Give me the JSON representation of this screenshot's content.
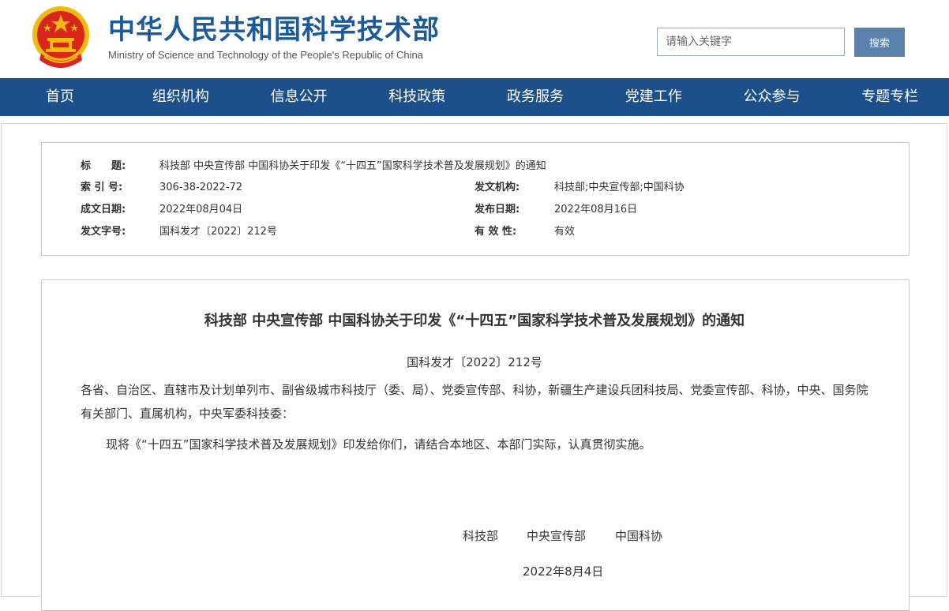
{
  "header": {
    "site_title": "中华人民共和国科学技术部",
    "site_subtitle": "Ministry of Science and Technology of the People's Republic of China",
    "search_placeholder": "请输入关键字",
    "search_button": "搜索"
  },
  "nav": {
    "items": [
      "首页",
      "组织机构",
      "信息公开",
      "科技政策",
      "政务服务",
      "党建工作",
      "公众参与",
      "专题专栏"
    ]
  },
  "meta": {
    "title_label": "标　　题:",
    "title_value": "科技部 中央宣传部 中国科协关于印发《“十四五”国家科学技术普及发展规划》的通知",
    "index_label": "索 引 号:",
    "index_value": "306-38-2022-72",
    "issuer_label": "发文机构:",
    "issuer_value": "科技部;中央宣传部;中国科协",
    "created_label": "成文日期:",
    "created_value": "2022年08月04日",
    "published_label": "发布日期:",
    "published_value": "2022年08月16日",
    "docno_label": "发文字号:",
    "docno_value": "国科发才〔2022〕212号",
    "validity_label": "有 效 性:",
    "validity_value": "有效"
  },
  "document": {
    "title": "科技部 中央宣传部 中国科协关于印发《“十四五”国家科学技术普及发展规划》的通知",
    "number": "国科发才〔2022〕212号",
    "addressees": "各省、自治区、直辖市及计划单列市、副省级城市科技厅（委、局）、党委宣传部、科协，新疆生产建设兵团科技局、党委宣传部、科协，中央、国务院有关部门、直属机构，中央军委科技委：",
    "body": "现将《“十四五”国家科学技术普及发展规划》印发给你们，请结合本地区、本部门实际，认真贯彻实施。",
    "signatories": [
      "科技部",
      "中央宣传部",
      "中国科协"
    ],
    "date": "2022年8月4日"
  },
  "colors": {
    "brand_blue": "#1d5a99",
    "nav_bg": "#1d4f8a",
    "emblem_red": "#d8261c",
    "emblem_gold": "#f2b90f"
  }
}
